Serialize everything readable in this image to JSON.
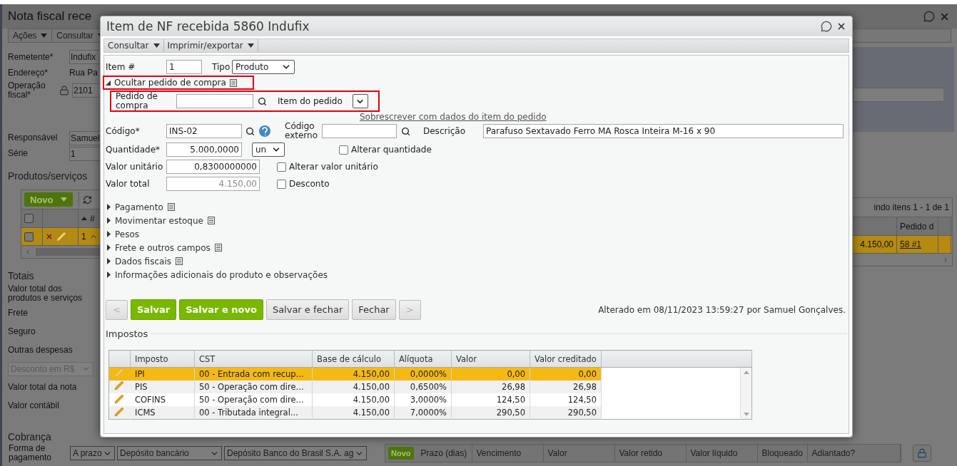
{
  "page": {
    "title": "Nota fiscal rece",
    "menu": [
      {
        "label": "Ações"
      },
      {
        "label": "Consultar"
      }
    ],
    "fields": [
      {
        "label": "Remetente*",
        "value": "Indufix",
        "kind": "input"
      },
      {
        "label": "Endereço*",
        "value": "Rua Pa",
        "kind": "text"
      },
      {
        "label": "Operação fiscal*",
        "value": "2101",
        "kind": "locked"
      }
    ],
    "fields_2": [
      {
        "label": "Responsável",
        "value": "Samuel",
        "kind": "input"
      },
      {
        "label": "Série",
        "value": "1",
        "kind": "input"
      }
    ],
    "products": {
      "title": "Produtos/serviços",
      "new_button": "Novo",
      "all_checked": false,
      "sort_header": "#",
      "pager": "indo itens 1 - 1 de 1",
      "order_column": "Pedido d",
      "rows": [
        {
          "number": "1",
          "checked": false,
          "selected": true,
          "value": "4.150,00",
          "order_link": "58 #1"
        }
      ]
    },
    "totals": {
      "title": "Totais",
      "items": [
        {
          "kind": "label",
          "text": "Valor total dos produtos e serviços"
        },
        {
          "kind": "label",
          "text": "Frete"
        },
        {
          "kind": "label",
          "text": "Seguro"
        },
        {
          "kind": "label",
          "text": "Outras despesas"
        },
        {
          "kind": "select",
          "text": "Desconto em R$",
          "disabled": true
        },
        {
          "kind": "label",
          "text": "Valor total da nota"
        },
        {
          "kind": "label",
          "text": "Valor contábil"
        }
      ]
    },
    "billing": {
      "title": "Cobrança",
      "label": "Forma de pagamento",
      "selects": [
        "A prazo",
        "Depósito bancário",
        "Depósito Banco do Brasil S.A. ag"
      ],
      "new_button": "Novo",
      "columns": [
        "Prazo (dias)",
        "Vencimento",
        "Valor",
        "Valor retido",
        "Valor líquido",
        "Bloqueado",
        "Adiantado?"
      ]
    }
  },
  "dialog": {
    "title": "Item de NF recebida 5860 Indufix",
    "menu": [
      {
        "label": "Consultar"
      },
      {
        "label": "Imprimir/exportar"
      }
    ],
    "item_number": {
      "label": "Item #",
      "value": "1"
    },
    "type": {
      "label": "Tipo",
      "value": "Produto"
    },
    "purchase_order": {
      "toggle": "Ocultar pedido de compra",
      "expanded": true,
      "toggle_highlighted": true,
      "fields_highlighted": true,
      "order_label": "Pedido de compra",
      "item_label": "Item do pedido",
      "link": "Sobrescrever com dados do item do pedido"
    },
    "code": {
      "label": "Código*",
      "value": "INS-02"
    },
    "external_code": {
      "label": "Código externo"
    },
    "description": {
      "label": "Descrição",
      "value": "Parafuso Sextavado Ferro MA Rosca Inteira M-16 x 90"
    },
    "quantity": {
      "label": "Quantidade*",
      "value": "5.000,0000",
      "unit": "un",
      "checkbox": {
        "label": "Alterar quantidade",
        "checked": false
      }
    },
    "unit_price": {
      "label": "Valor unitário",
      "value": "0,8300000000",
      "checkbox": {
        "label": "Alterar valor unitário",
        "checked": false
      }
    },
    "total": {
      "label": "Valor total",
      "value": "4.150,00",
      "disabled": true,
      "checkbox": {
        "label": "Desconto",
        "checked": false
      }
    },
    "sections": [
      {
        "label": "Pagamento",
        "expanded": false,
        "has_note": true
      },
      {
        "label": "Movimentar estoque",
        "expanded": false,
        "has_note": true
      },
      {
        "label": "Pesos",
        "expanded": false,
        "has_note": false
      },
      {
        "label": "Frete e outros campos",
        "expanded": false,
        "has_note": true
      },
      {
        "label": "Dados fiscais",
        "expanded": false,
        "has_note": true
      },
      {
        "label": "Informações adicionais do produto e observações",
        "expanded": false,
        "has_note": false
      }
    ],
    "buttons": [
      {
        "label": "<",
        "kind": "nav",
        "disabled": true
      },
      {
        "label": "Salvar",
        "kind": "primary",
        "disabled": false
      },
      {
        "label": "Salvar e novo",
        "kind": "primary",
        "disabled": false
      },
      {
        "label": "Salvar e fechar",
        "kind": "secondary",
        "disabled": false
      },
      {
        "label": "Fechar",
        "kind": "secondary",
        "disabled": false
      },
      {
        "label": ">",
        "kind": "nav",
        "disabled": true
      }
    ],
    "audit": "Alterado em 08/11/2023 13:59:27 por Samuel Gonçalves.",
    "taxes": {
      "title": "Impostos",
      "columns": [
        "Imposto",
        "CST",
        "Base de cálculo",
        "Alíquota",
        "Valor",
        "Valor creditado"
      ],
      "rows": [
        {
          "selected": true,
          "cells": [
            "IPI",
            "00 - Entrada com recup...",
            "4.150,00",
            "0,0000%",
            "0,00",
            "0,00"
          ]
        },
        {
          "selected": false,
          "cells": [
            "PIS",
            "50 - Operação com dire...",
            "4.150,00",
            "0,6500%",
            "26,98",
            "26,98"
          ]
        },
        {
          "selected": false,
          "cells": [
            "COFINS",
            "50 - Operação com dire...",
            "4.150,00",
            "3,0000%",
            "124,50",
            "124,50"
          ]
        },
        {
          "selected": false,
          "cells": [
            "ICMS",
            "00 - Tributada integral...",
            "4.150,00",
            "7,0000%",
            "290,50",
            "290,50"
          ]
        }
      ]
    }
  }
}
